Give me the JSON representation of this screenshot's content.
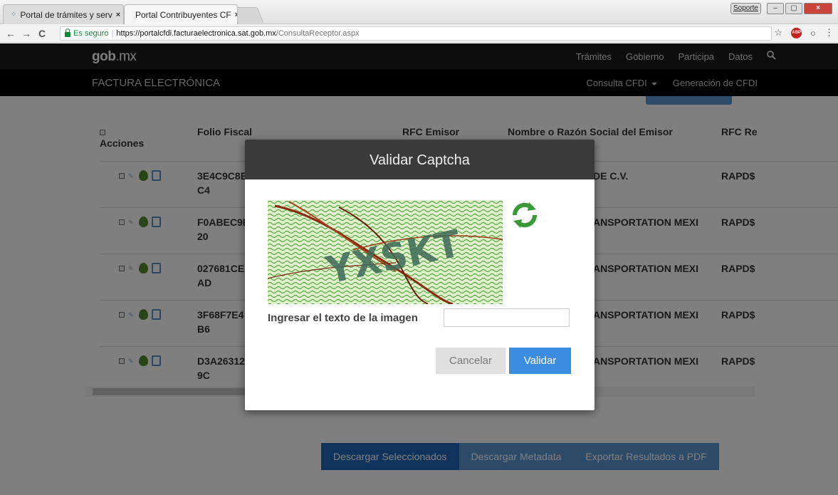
{
  "browser": {
    "tabs": [
      {
        "title": "Portal de trámites y serv",
        "close": "×"
      },
      {
        "title": "Portal Contribuyentes CF",
        "close": "×"
      }
    ],
    "window_buttons": {
      "support": "Soporte",
      "minimize": "–",
      "maximize": "▢",
      "close": "×"
    },
    "nav": {
      "back": "←",
      "forward": "→",
      "reload": "C"
    },
    "secure_label": "Es seguro",
    "separator": "|",
    "url_host": "https://portalcfdi.facturaelectronica.sat.gob.mx",
    "url_path": "/ConsultaReceptor.aspx",
    "star": "☆",
    "abp": "ABP",
    "menu": "⋮",
    "circle": "○"
  },
  "header": {
    "brand_a": "gob",
    "brand_b": "mx",
    "nav": [
      "Trámites",
      "Gobierno",
      "Participa",
      "Datos"
    ],
    "search_icon": "🔍",
    "subbrand": "FACTURA ELECTRÓNICA",
    "subnav": [
      "Consulta CFDI",
      "Generación de CFDI"
    ]
  },
  "table": {
    "headers": {
      "acciones": "Acciones",
      "folio": "Folio Fiscal",
      "rfc_emisor": "RFC Emisor",
      "nombre": "Nombre o Razón Social del Emisor",
      "rfc_receptor": "RFC Re"
    },
    "rows": [
      {
        "folio_a": "3E4C9C8E",
        "folio_b": "C4",
        "nombre": "DE C.V.",
        "rfc": "RAPD$"
      },
      {
        "folio_a": "F0ABEC9E",
        "folio_b": "20",
        "nombre": "ANSPORTATION MEXI",
        "rfc": "RAPD$"
      },
      {
        "folio_a": "027681CE",
        "folio_b": "AD",
        "nombre": "ANSPORTATION MEXI",
        "rfc": "RAPD$"
      },
      {
        "folio_a": "3F68F7E4",
        "folio_b": "B6",
        "nombre": "ANSPORTATION MEXI",
        "rfc": "RAPD$"
      },
      {
        "folio_a": "D3A26312",
        "folio_b": "9C",
        "nombre": "ANSPORTATION MEXI",
        "rfc": "RAPD$"
      }
    ]
  },
  "actions": {
    "descargar_seleccionados": "Descargar Seleccionados",
    "descargar_metadata": "Descargar Metadata",
    "exportar_pdf": "Exportar Resultados a PDF"
  },
  "modal": {
    "title": "Validar Captcha",
    "captcha_text": "YXSKT",
    "input_label": "Ingresar el texto de la imagen",
    "input_value": "",
    "cancel_label": "Cancelar",
    "submit_label": "Validar"
  },
  "colors": {
    "primary_blue": "#2166b8",
    "light_blue": "#5a94d2",
    "validar_blue": "#3b8de0",
    "captcha_green": "#2f8f3a"
  }
}
